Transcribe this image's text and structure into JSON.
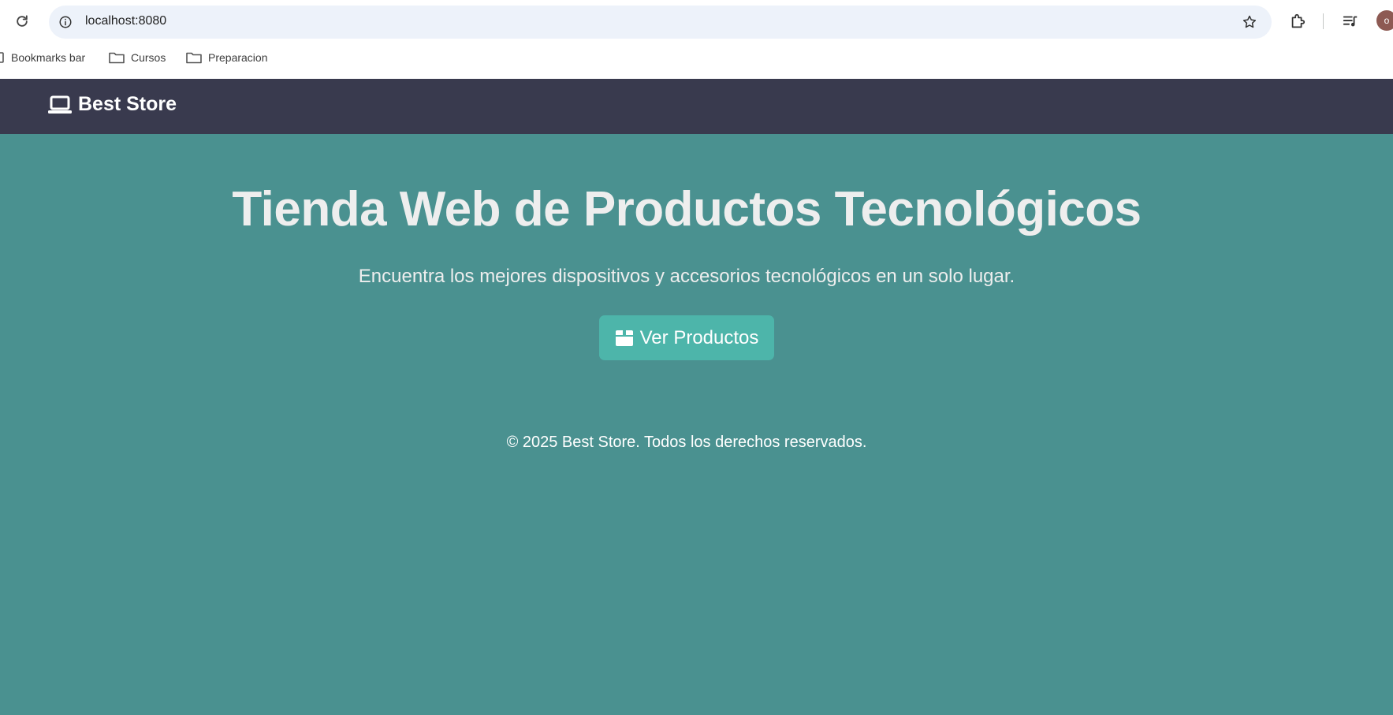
{
  "browser": {
    "url": "localhost:8080",
    "avatar_initial": "o",
    "bookmarks": [
      {
        "label": "Bookmarks bar",
        "icon": "bookmark-icon"
      },
      {
        "label": "Cursos",
        "icon": "folder-icon"
      },
      {
        "label": "Preparacion",
        "icon": "folder-icon"
      }
    ]
  },
  "navbar": {
    "brand": "Best Store",
    "brand_icon": "laptop-icon"
  },
  "hero": {
    "title": "Tienda Web de Productos Tecnológicos",
    "subtitle": "Encuentra los mejores dispositivos y accesorios tecnológicos en un solo lugar.",
    "cta_label": "Ver Productos",
    "cta_icon": "box-icon"
  },
  "footer": {
    "text": "© 2025 Best Store. Todos los derechos reservados."
  },
  "colors": {
    "navbar_bg": "#393a4e",
    "page_bg": "#4a9190",
    "button_bg": "#4db5aa"
  }
}
